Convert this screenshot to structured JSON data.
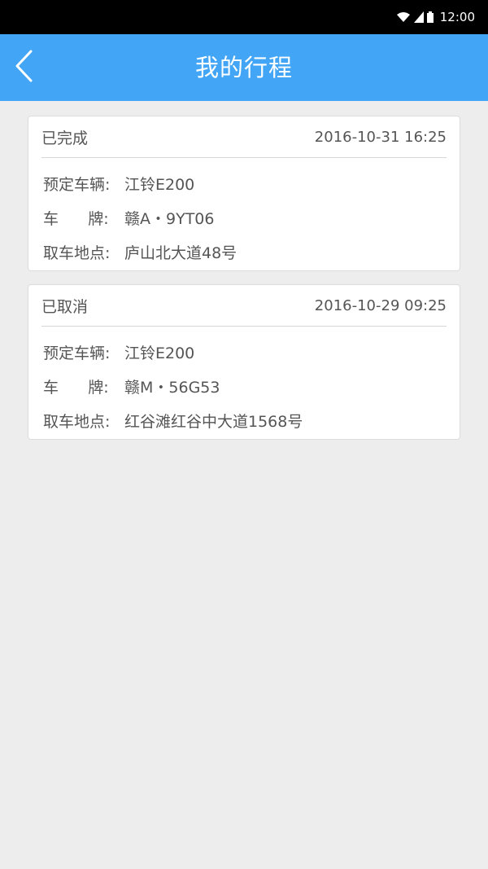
{
  "status_bar": {
    "time": "12:00",
    "icons": [
      "wifi-icon",
      "signal-icon",
      "battery-icon"
    ]
  },
  "header": {
    "title": "我的行程",
    "back_icon": "chevron-left-icon"
  },
  "trips": [
    {
      "status": "已完成",
      "datetime": "2016-10-31 16:25",
      "vehicle_label": "预定车辆:",
      "vehicle": "江铃E200",
      "plate_label": "车      牌:",
      "plate": "赣A・9YT06",
      "pickup_label": "取车地点:",
      "pickup": "庐山北大道48号"
    },
    {
      "status": "已取消",
      "datetime": "2016-10-29 09:25",
      "vehicle_label": "预定车辆:",
      "vehicle": "江铃E200",
      "plate_label": "车      牌:",
      "plate": "赣M・56G53",
      "pickup_label": "取车地点:",
      "pickup": "红谷滩红谷中大道1568号"
    }
  ],
  "colors": {
    "nav": "#42a5f5",
    "background": "#ededed",
    "card": "#ffffff",
    "text": "#555555"
  }
}
